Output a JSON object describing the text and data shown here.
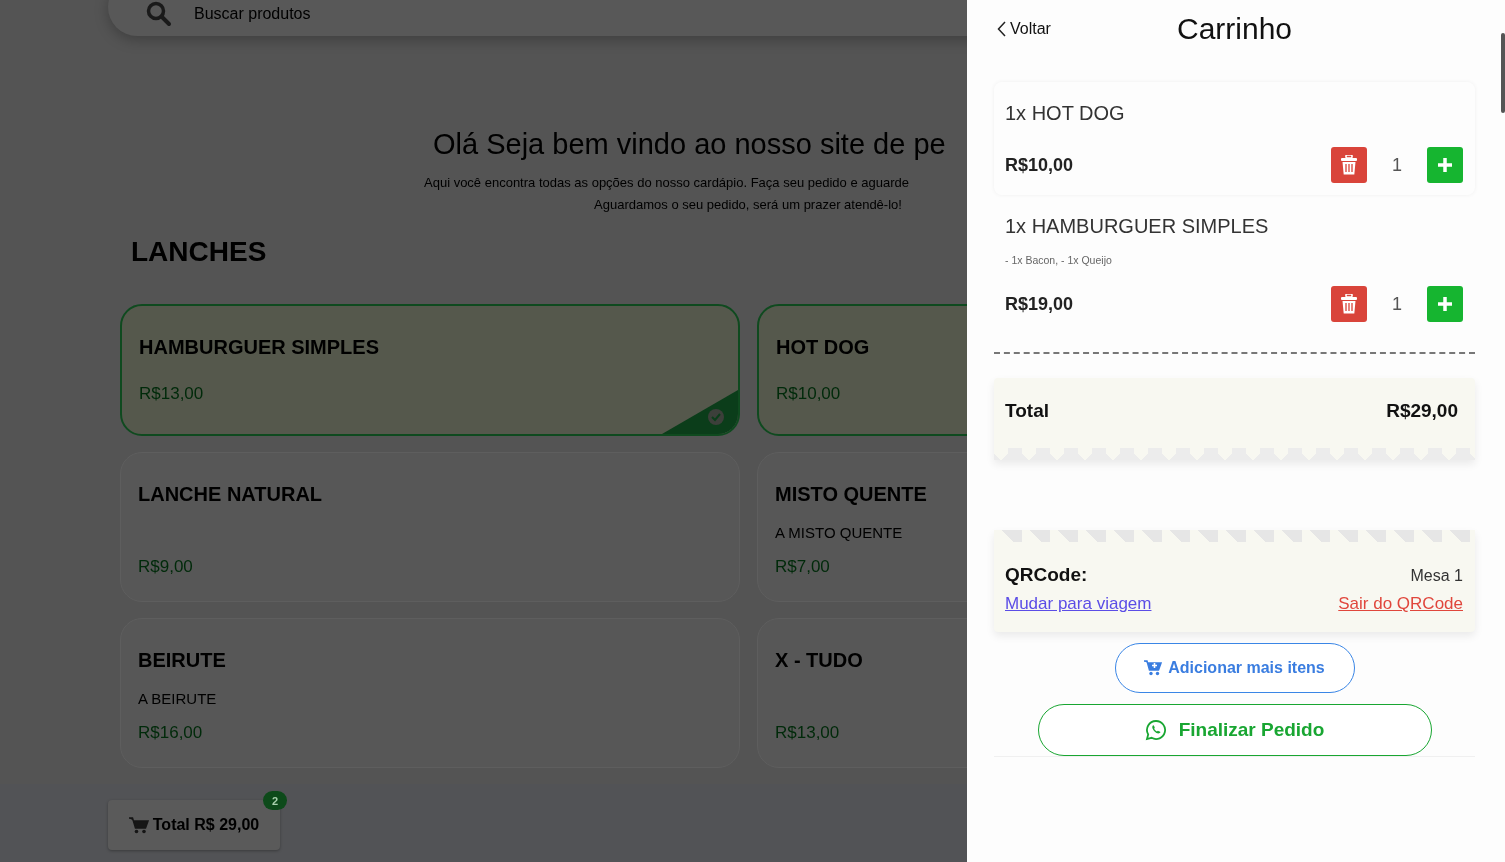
{
  "search": {
    "placeholder": "Buscar produtos"
  },
  "intro": {
    "title": "Olá Seja bem vindo ao nosso site de pe",
    "lines": [
      "Aqui você encontra todas as opções do nosso cardápio. Faça seu pedido e aguarde",
      "Aguardamos o seu pedido, será um prazer atendê-lo!"
    ]
  },
  "section": "LANCHES",
  "products": [
    {
      "name": "HAMBURGUER SIMPLES",
      "price": "R$13,00",
      "selected": true
    },
    {
      "name": "HOT DOG",
      "price": "R$10,00",
      "selected": true
    },
    {
      "name": "LANCHE NATURAL",
      "price": "R$9,00",
      "selected": false
    },
    {
      "name": "MISTO QUENTE",
      "description": "A MISTO QUENTE",
      "price": "R$7,00",
      "selected": false
    },
    {
      "name": "BEIRUTE",
      "description": "A BEIRUTE",
      "price": "R$16,00",
      "selected": false
    },
    {
      "name": "X - TUDO",
      "price": "R$13,00",
      "selected": false
    }
  ],
  "cart_bar": {
    "label": "Total R$ 29,00",
    "count": "2"
  },
  "cart": {
    "back": "Voltar",
    "title": "Carrinho",
    "items": [
      {
        "name": "1x HOT DOG",
        "price": "R$10,00",
        "quantity": "1"
      },
      {
        "name": "1x HAMBURGUER SIMPLES",
        "extras": "- 1x Bacon, - 1x Queijo",
        "price": "R$19,00",
        "quantity": "1"
      }
    ],
    "total_label": "Total",
    "total": "R$29,00",
    "qrcode": {
      "label": "QRCode:",
      "table": "Mesa 1",
      "switch_link": "Mudar para viagem",
      "exit_link": "Sair do QRCode"
    },
    "add_more": "Adicionar mais itens",
    "finish": "Finalizar Pedido"
  }
}
